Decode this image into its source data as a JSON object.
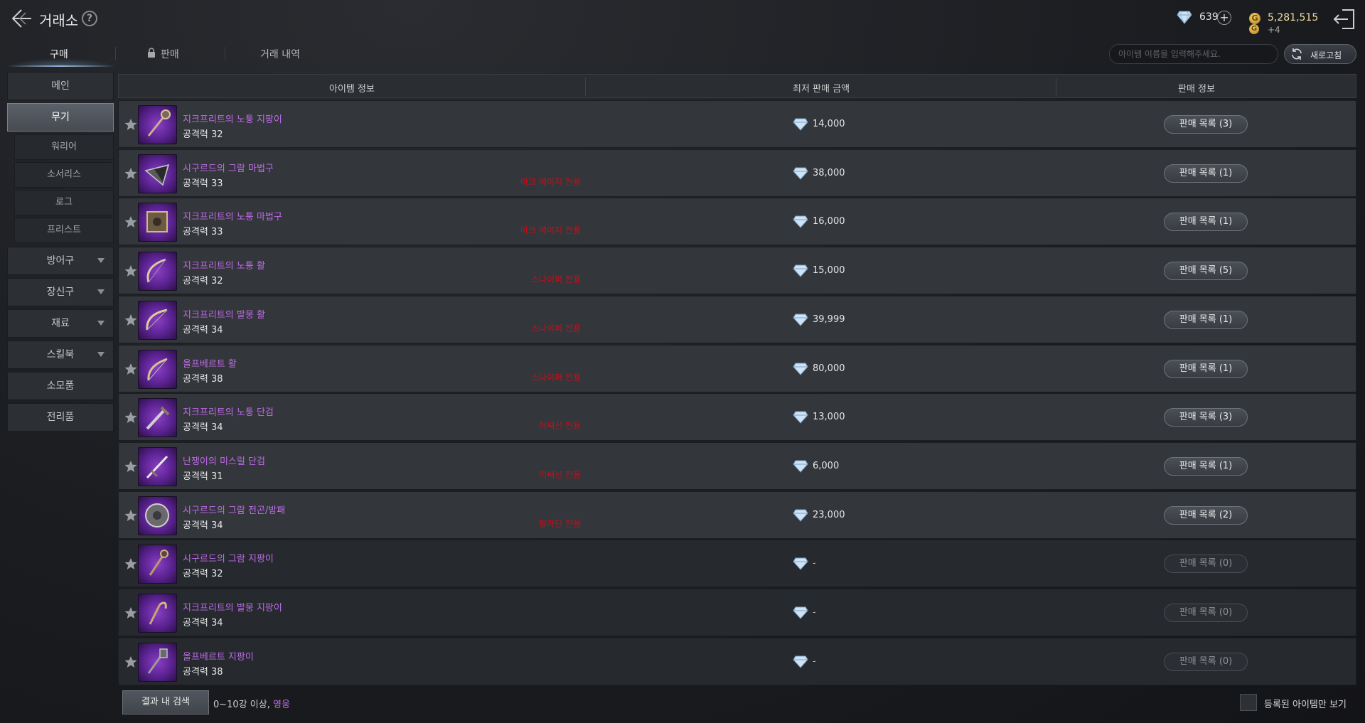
{
  "header": {
    "title": "거래소",
    "crystal_amount": "639",
    "gold_amount": "5,281,515",
    "gold_sub": "+4"
  },
  "tabs": [
    {
      "label": "구매"
    },
    {
      "label": "판매"
    },
    {
      "label": "거래 내역"
    }
  ],
  "search": {
    "placeholder": "아이템 이름을 입력해주세요.",
    "refresh_label": "새로고침"
  },
  "sidebar": {
    "main": "메인",
    "weapon": "무기",
    "weapon_sub": [
      "워리어",
      "소서리스",
      "로그",
      "프리스트"
    ],
    "armor": "방어구",
    "accessory": "장신구",
    "material": "재료",
    "skillbook": "스킬북",
    "consumable": "소모품",
    "trophy": "전리품"
  },
  "table": {
    "col_item": "아이템 정보",
    "col_price": "최저 판매 금액",
    "col_sale": "판매 정보",
    "rows": [
      {
        "name": "지크프리트의 노퉁 지팡이",
        "stat": "공격력 32",
        "tag": "",
        "price": "14,000",
        "list": "판매 목록 (3)"
      },
      {
        "name": "시구르드의 그람 마법구",
        "stat": "공격력 33",
        "tag": "아크 메이지 전용",
        "price": "38,000",
        "list": "판매 목록 (1)"
      },
      {
        "name": "지크프리트의 노퉁 마법구",
        "stat": "공격력 33",
        "tag": "아크 메이지 전용",
        "price": "16,000",
        "list": "판매 목록 (1)"
      },
      {
        "name": "지크프리트의 노퉁 활",
        "stat": "공격력 32",
        "tag": "스나이퍼 전용",
        "price": "15,000",
        "list": "판매 목록 (5)"
      },
      {
        "name": "지크프리트의 발뭉 활",
        "stat": "공격력 34",
        "tag": "스나이퍼 전용",
        "price": "39,999",
        "list": "판매 목록 (1)"
      },
      {
        "name": "올프베르트 활",
        "stat": "공격력 38",
        "tag": "스나이퍼 전용",
        "price": "80,000",
        "list": "판매 목록 (1)"
      },
      {
        "name": "지크프리트의 노퉁 단검",
        "stat": "공격력 34",
        "tag": "어쌔신 전용",
        "price": "13,000",
        "list": "판매 목록 (3)"
      },
      {
        "name": "난쟁이의 미스릴 단검",
        "stat": "공격력 31",
        "tag": "어쌔신 전용",
        "price": "6,000",
        "list": "판매 목록 (1)"
      },
      {
        "name": "시구르드의 그람 전곤/방패",
        "stat": "공격력 34",
        "tag": "팔라딘 전용",
        "price": "23,000",
        "list": "판매 목록 (2)"
      },
      {
        "name": "시구르드의 그람 지팡이",
        "stat": "공격력 32",
        "tag": "",
        "price": "-",
        "list": "판매 목록 (0)"
      },
      {
        "name": "지크프리트의 발뭉 지팡이",
        "stat": "공격력 34",
        "tag": "",
        "price": "-",
        "list": "판매 목록 (0)"
      },
      {
        "name": "올프베르트 지팡이",
        "stat": "공격력 38",
        "tag": "",
        "price": "-",
        "list": "판매 목록 (0)"
      }
    ]
  },
  "footer": {
    "search_results_label": "결과 내 검색",
    "filter_prefix": "0~10강 이상, ",
    "filter_highlight": "영웅",
    "registered_only_label": "등록된 아이템만 보기"
  },
  "colors": {
    "item_name": "#c06bea",
    "class_tag": "#c1121b",
    "gold": "#f2e0a4"
  }
}
